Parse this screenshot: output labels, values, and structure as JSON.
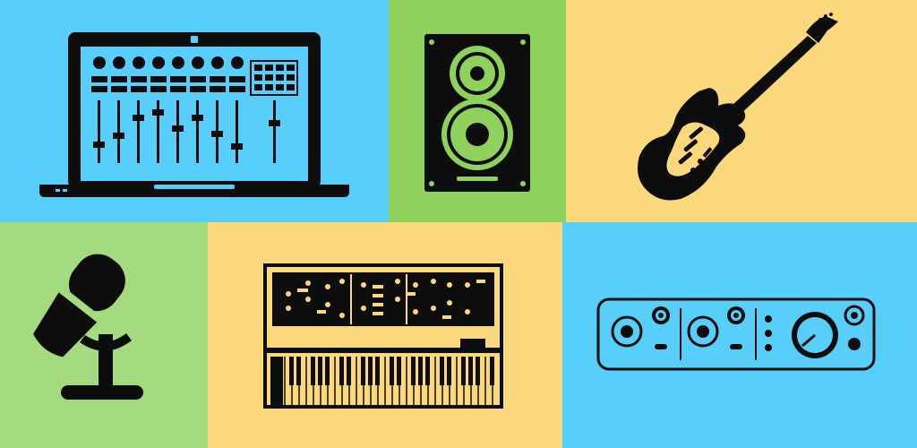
{
  "palette": {
    "blue": "#58cffb",
    "green": "#a3db7e",
    "lime": "#8ed25d",
    "yellow": "#fbd87c",
    "ink": "#0d0d0d"
  },
  "tiles": [
    {
      "name": "laptop-mixer-tile",
      "color": "blue",
      "icon": "laptop-mixer-icon"
    },
    {
      "name": "studio-monitor-tile",
      "color": "lime",
      "icon": "speaker-icon"
    },
    {
      "name": "electric-guitar-tile",
      "color": "yellow",
      "icon": "electric-guitar-icon"
    },
    {
      "name": "microphone-tile",
      "color": "green",
      "icon": "microphone-icon"
    },
    {
      "name": "synthesizer-tile",
      "color": "yellow",
      "icon": "synthesizer-icon"
    },
    {
      "name": "audio-interface-tile",
      "color": "blue",
      "icon": "audio-interface-icon"
    }
  ]
}
